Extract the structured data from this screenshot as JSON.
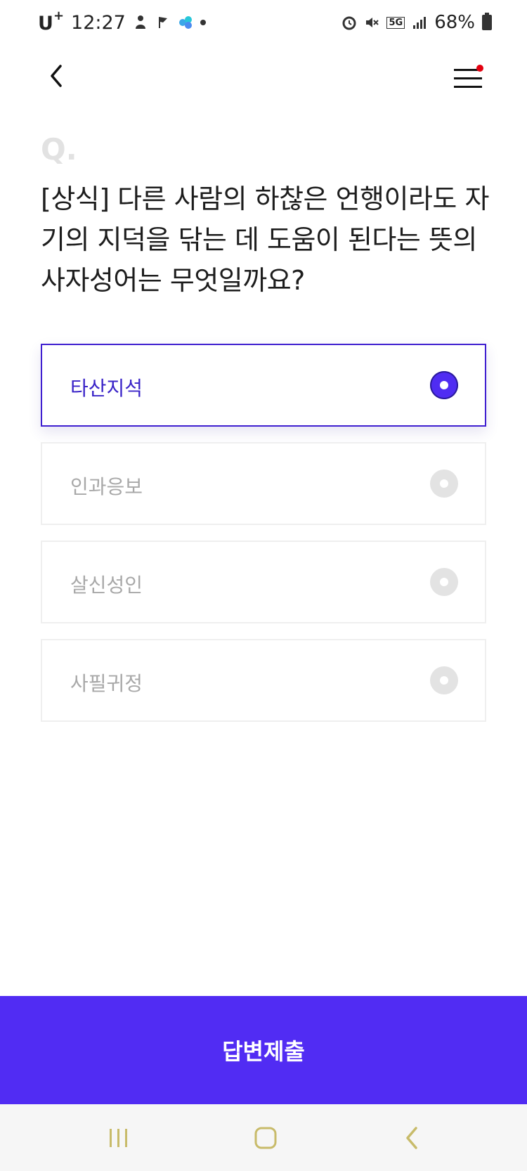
{
  "status_bar": {
    "carrier": "U",
    "carrier_sup": "+",
    "time": "12:27",
    "network": "5G",
    "battery": "68%"
  },
  "header": {
    "back_icon": "chevron-left-icon",
    "menu_icon": "hamburger-menu-icon",
    "menu_badge_color": "#e3000f"
  },
  "quiz": {
    "q_marker": "Q.",
    "question": "[상식] 다른 사람의 하찮은 언행이라도 자기의 지덕을 닦는 데 도움이 된다는 뜻의 사자성어는 무엇일까요?",
    "options": [
      {
        "label": "타산지석",
        "selected": true
      },
      {
        "label": "인과응보",
        "selected": false
      },
      {
        "label": "살신성인",
        "selected": false
      },
      {
        "label": "사필귀정",
        "selected": false
      }
    ]
  },
  "submit_label": "답변제출",
  "colors": {
    "accent": "#512cf3",
    "selected_text": "#3a24c8",
    "nav_icon": "#c8bb6a"
  },
  "nav": {
    "recent_icon": "recent-apps-icon",
    "home_icon": "home-icon",
    "back_icon": "back-icon"
  }
}
